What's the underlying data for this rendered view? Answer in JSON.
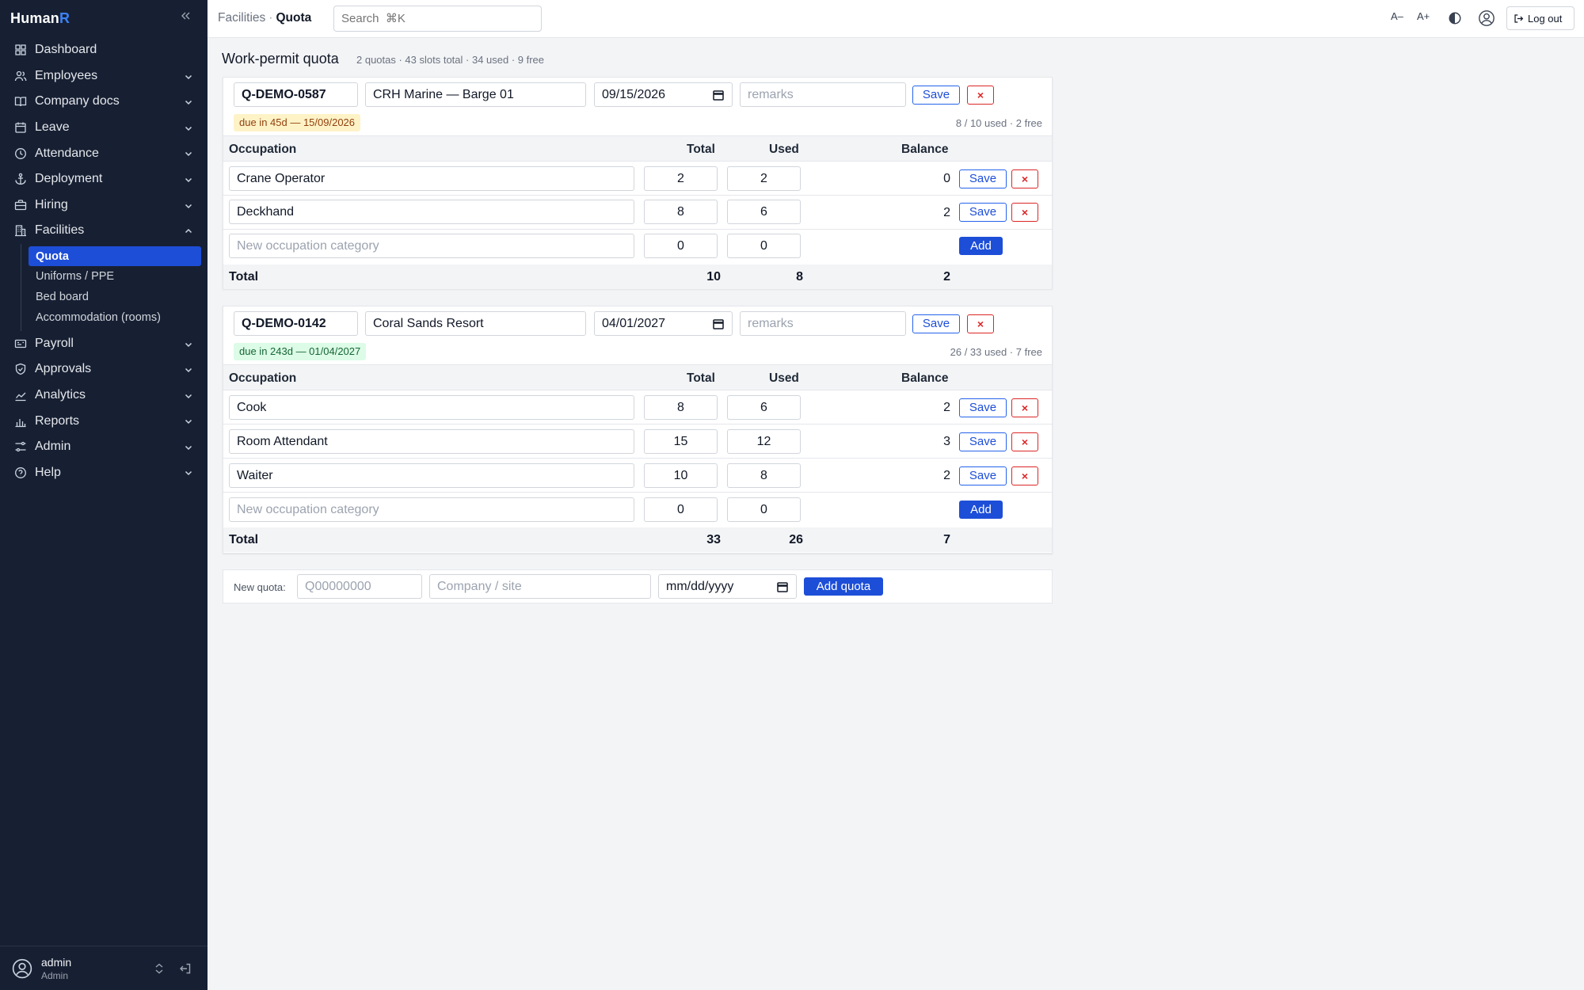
{
  "app": {
    "brand_main": "Human",
    "brand_accent": "R"
  },
  "sidebar": {
    "items": [
      {
        "label": "Dashboard",
        "icon": "dashboard-icon",
        "expandable": false
      },
      {
        "label": "Employees",
        "icon": "users-icon",
        "expandable": true
      },
      {
        "label": "Company docs",
        "icon": "book-icon",
        "expandable": true
      },
      {
        "label": "Leave",
        "icon": "calendar-icon",
        "expandable": true
      },
      {
        "label": "Attendance",
        "icon": "clock-icon",
        "expandable": true
      },
      {
        "label": "Deployment",
        "icon": "anchor-icon",
        "expandable": true
      },
      {
        "label": "Hiring",
        "icon": "briefcase-icon",
        "expandable": true
      },
      {
        "label": "Facilities",
        "icon": "building-icon",
        "expandable": true,
        "expanded": true
      },
      {
        "label": "Payroll",
        "icon": "payroll-icon",
        "expandable": true
      },
      {
        "label": "Approvals",
        "icon": "shield-check-icon",
        "expandable": true
      },
      {
        "label": "Analytics",
        "icon": "line-chart-icon",
        "expandable": true
      },
      {
        "label": "Reports",
        "icon": "bar-chart-icon",
        "expandable": true
      },
      {
        "label": "Admin",
        "icon": "sliders-icon",
        "expandable": true
      },
      {
        "label": "Help",
        "icon": "help-icon",
        "expandable": true
      }
    ],
    "facilities_sub": [
      {
        "label": "Quota",
        "active": true
      },
      {
        "label": "Uniforms / PPE",
        "active": false
      },
      {
        "label": "Bed board",
        "active": false
      },
      {
        "label": "Accommodation (rooms)",
        "active": false
      }
    ],
    "user": {
      "name": "admin",
      "role": "Admin"
    }
  },
  "topbar": {
    "breadcrumb": [
      "Facilities",
      "Quota"
    ],
    "breadcrumb_sep": "·",
    "search_placeholder": "Search  ⌘K",
    "font_decrease": "A–",
    "font_increase": "A+",
    "logout_label": "Log out"
  },
  "page": {
    "title": "Work-permit quota",
    "summary": "2 quotas · 43 slots total · 34 used · 9 free"
  },
  "table_headers": {
    "occupation": "Occupation",
    "total": "Total",
    "used": "Used",
    "balance": "Balance"
  },
  "labels": {
    "save": "Save",
    "delete": "×",
    "add": "Add",
    "total_row": "Total",
    "remarks_placeholder": "remarks",
    "new_occupation_placeholder": "New occupation category"
  },
  "quotas": [
    {
      "id": "Q-DEMO-0587",
      "site": "CRH Marine — Barge 01",
      "date": "09/15/2026",
      "remarks": "",
      "due_badge": "due in 45d — 15/09/2026",
      "due_status": "warning",
      "usage": "8 / 10 used · 2 free",
      "rows": [
        {
          "occupation": "Crane Operator",
          "total": "2",
          "used": "2",
          "balance": "0"
        },
        {
          "occupation": "Deckhand",
          "total": "8",
          "used": "6",
          "balance": "2"
        }
      ],
      "new_row": {
        "total": "0",
        "used": "0"
      },
      "totals": {
        "total": "10",
        "used": "8",
        "balance": "2"
      }
    },
    {
      "id": "Q-DEMO-0142",
      "site": "Coral Sands Resort",
      "date": "04/01/2027",
      "remarks": "",
      "due_badge": "due in 243d — 01/04/2027",
      "due_status": "ok",
      "usage": "26 / 33 used · 7 free",
      "rows": [
        {
          "occupation": "Cook",
          "total": "8",
          "used": "6",
          "balance": "2"
        },
        {
          "occupation": "Room Attendant",
          "total": "15",
          "used": "12",
          "balance": "3"
        },
        {
          "occupation": "Waiter",
          "total": "10",
          "used": "8",
          "balance": "2"
        }
      ],
      "new_row": {
        "total": "0",
        "used": "0"
      },
      "totals": {
        "total": "33",
        "used": "26",
        "balance": "7"
      }
    }
  ],
  "new_quota": {
    "label": "New quota:",
    "id_placeholder": "Q00000000",
    "site_placeholder": "Company / site",
    "date_placeholder": "mm/dd/yyyy",
    "button_label": "Add quota"
  },
  "colors": {
    "sidebar_bg": "#172033",
    "accent": "#1d4ed8",
    "danger": "#dc2626",
    "warn_badge": "#fef3c7",
    "ok_badge": "#dcfce7"
  }
}
